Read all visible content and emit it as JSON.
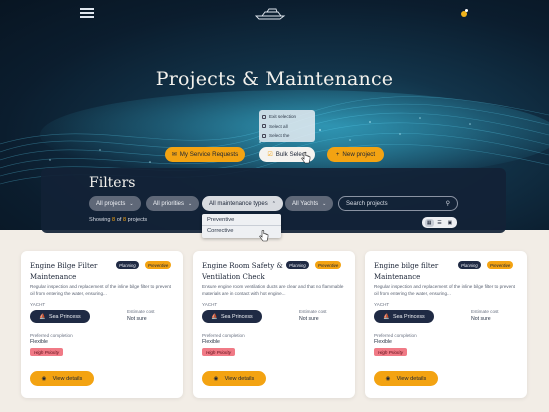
{
  "header": {
    "menu_icon": "hamburger-icon",
    "logo_icon": "yacht-logo-icon",
    "notification_icon": "bell-icon"
  },
  "hero": {
    "title": "Projects & Maintenance"
  },
  "actions": {
    "service_requests": "My Service Requests",
    "bulk_select": "Bulk Select",
    "new_project": "New project",
    "bulk_menu": [
      "Exit selection",
      "Select all",
      "Select the"
    ]
  },
  "filters": {
    "title": "Filters",
    "chips": [
      "All projects",
      "All priorities",
      "All maintenance types",
      "All Yachts"
    ],
    "search_placeholder": "Search projects",
    "showing_prefix": "Showing",
    "showing_count": "8",
    "showing_of": "of",
    "showing_total": "8",
    "showing_suffix": "projects",
    "maintenance_options": [
      "Preventive",
      "Corrective"
    ]
  },
  "cards": [
    {
      "title": "Engine Bilge Filter Maintenance",
      "tags": [
        "Planning",
        "Preventive"
      ],
      "description": "Regular inspection and replacement of the inline bilge filter to prevent oil from entering the water, ensuring...",
      "yacht_label": "YACHT",
      "yacht": "Sea Princess",
      "cost_label": "Estimate cost",
      "cost": "Not sure",
      "completion_label": "Preferred completion",
      "completion": "Flexible",
      "priority": "High Priority",
      "button": "View details"
    },
    {
      "title": "Engine Room Safety & Ventilation Check",
      "tags": [
        "Planning",
        "Preventive"
      ],
      "description": "Ensure engine room ventilation ducts are clear and that no flammable materials are in contact with hot engine...",
      "yacht_label": "YACHT",
      "yacht": "Sea Princess",
      "cost_label": "Estimate cost",
      "cost": "Not sure",
      "completion_label": "Preferred completion",
      "completion": "Flexible",
      "priority": "High Priority",
      "button": "View details"
    },
    {
      "title": "Engine bilge filter Maintenance",
      "tags": [
        "Planning",
        "Preventive"
      ],
      "description": "Regular inspection and replacement of the inline bilge filter to prevent oil from entering the water, ensuring...",
      "yacht_label": "YACHT",
      "yacht": "Sea Princess",
      "cost_label": "Estimate cost",
      "cost": "Not sure",
      "completion_label": "Preferred completion",
      "completion": "Flexible",
      "priority": "High Priority",
      "button": "View details"
    }
  ],
  "colors": {
    "accent": "#f3a312",
    "navy": "#1f2a44",
    "priority": "#f07a86"
  }
}
